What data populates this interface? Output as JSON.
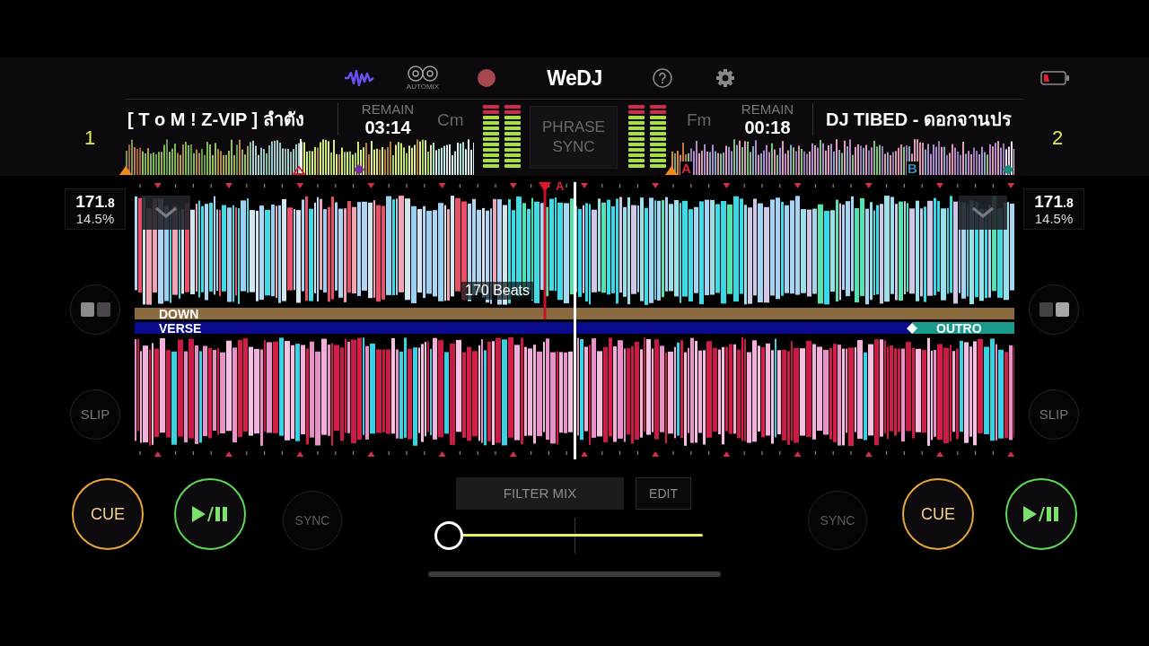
{
  "toolbar": {
    "logo": "WeDJ",
    "automix_label": "AUTOMIX"
  },
  "decks": [
    {
      "number": "1",
      "title": "[ T o M ! Z-VIP ] ลำตัง",
      "remain_label": "REMAIN",
      "remain": "03:14",
      "key": "Cm",
      "meters": [
        {
          "level": 1
        },
        {
          "level": 1
        }
      ],
      "bpm": "171",
      "bpm_fraction": ".8",
      "tempo": "14.5%",
      "slip": "SLIP",
      "cue": "CUE",
      "sync": "SYNC"
    },
    {
      "number": "2",
      "title": "DJ TIBED - ดอกจานปร",
      "remain_label": "REMAIN",
      "remain": "00:18",
      "key": "Fm",
      "meters": [
        {
          "level": 1
        },
        {
          "level": 1
        }
      ],
      "overview_cues": [
        {
          "label": "A",
          "color": "#e0203c"
        },
        {
          "label": "B",
          "color": "#3a8cb8"
        }
      ],
      "bpm": "171",
      "bpm_fraction": ".8",
      "tempo": "14.5%",
      "slip": "SLIP",
      "cue": "CUE",
      "sync": "SYNC"
    }
  ],
  "phrase_sync": "PHRASE SYNC",
  "waveform": {
    "cue_label": "A",
    "beats_label": "170 Beats",
    "upper_phrases": [
      {
        "label": "DOWN",
        "color": "#8a6a3e"
      }
    ],
    "lower_phrases": [
      {
        "label": "VERSE",
        "color": "#0a0a8c"
      },
      {
        "label": "OUTRO",
        "color": "#1a9a8a"
      }
    ]
  },
  "mixer": {
    "filter_mix": "FILTER MIX",
    "edit": "EDIT",
    "crossfader": {
      "level": 0
    }
  }
}
